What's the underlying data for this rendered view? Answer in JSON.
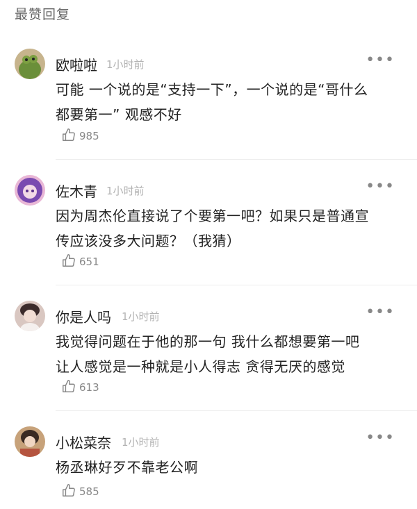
{
  "section_title": "最赞回复",
  "comments": [
    {
      "username": "欧啦啦",
      "time": "1小时前",
      "lines": [
        "可能 一个说的是“支持一下”，一个说的是“哥什么",
        "都要第一” 观感不好"
      ],
      "likes": "985",
      "avatar_colors": [
        "#6b8f3a",
        "#c7b48d"
      ]
    },
    {
      "username": "佐木青",
      "time": "1小时前",
      "lines": [
        "因为周杰伦直接说了个要第一吧？如果只是普通宣",
        "传应该没多大问题？（我猜）"
      ],
      "likes": "651",
      "avatar_colors": [
        "#7a4ab0",
        "#e9b7d6"
      ]
    },
    {
      "username": "你是人吗",
      "time": "1小时前",
      "lines": [
        "我觉得问题在于他的那一句 我什么都想要第一吧",
        "让人感觉是一种就是小人得志 贪得无厌的感觉"
      ],
      "likes": "613",
      "avatar_colors": [
        "#d9c7c1",
        "#3b2b2b"
      ]
    },
    {
      "username": "小松菜奈",
      "time": "1小时前",
      "lines": [
        "杨丞琳好歹不靠老公啊"
      ],
      "likes": "585",
      "avatar_colors": [
        "#c7a27a",
        "#3a2a22"
      ]
    }
  ],
  "icons": {
    "more": "more-dots-icon",
    "like": "thumbs-up-icon"
  }
}
